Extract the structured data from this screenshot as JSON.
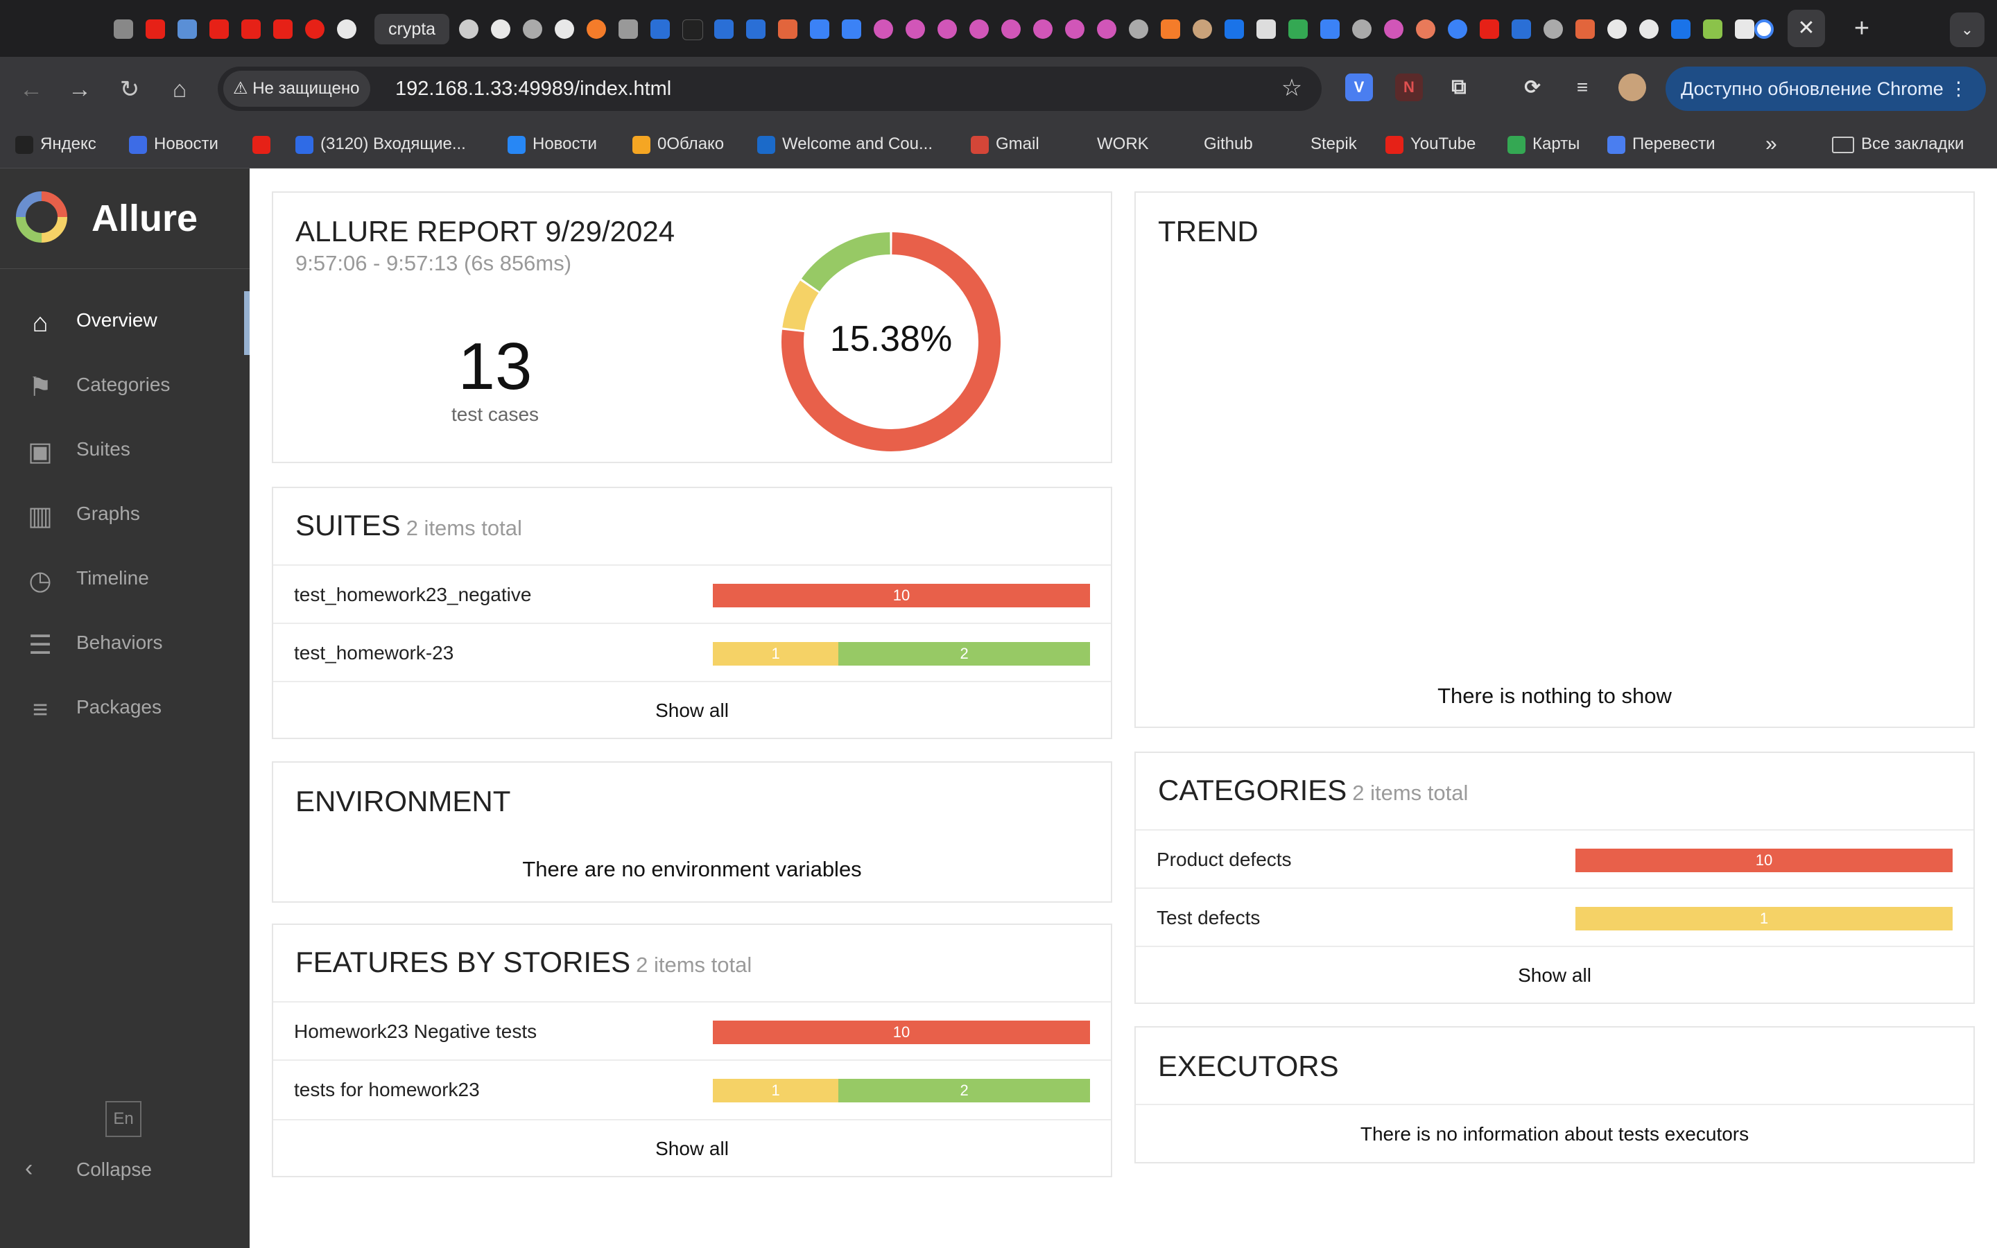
{
  "browser": {
    "active_tab_label": "crypta",
    "tab_close": "✕",
    "new_tab": "+",
    "tab_search": "⌄",
    "security_label": "Не защищено",
    "url": "192.168.1.33:49989/index.html",
    "update_button": "Доступно обновление Chrome",
    "bookmarks": [
      {
        "label": "Яндекс",
        "icon": "yandex-icon",
        "color": "#222222"
      },
      {
        "label": "Новости",
        "icon": "news-icon",
        "color": "#3d6ce6"
      },
      {
        "label": "",
        "icon": "youtube-icon",
        "color": "#e62117"
      },
      {
        "label": "(3120) Входящие...",
        "icon": "mail-icon",
        "color": "#2f6be6"
      },
      {
        "label": "Новости",
        "icon": "vk-icon",
        "color": "#2787f5"
      },
      {
        "label": "0Облако",
        "icon": "cloud-icon",
        "color": "#f5a623"
      },
      {
        "label": "Welcome and Cou...",
        "icon": "c-icon",
        "color": "#1b6ac9"
      },
      {
        "label": "Gmail",
        "icon": "gmail-icon",
        "color": "#d44638"
      },
      {
        "label": "WORK",
        "icon": "folder-icon",
        "color": "#38383b"
      },
      {
        "label": "Github",
        "icon": "github-icon",
        "color": "#38383b"
      },
      {
        "label": "Stepik",
        "icon": "stepik-icon",
        "color": "#38383b"
      },
      {
        "label": "YouTube",
        "icon": "youtube-icon",
        "color": "#e62117"
      },
      {
        "label": "Карты",
        "icon": "maps-icon",
        "color": "#34a853"
      },
      {
        "label": "Перевести",
        "icon": "translate-icon",
        "color": "#4a7ef0"
      }
    ],
    "more_bookmarks": "»",
    "all_bookmarks": "Все закладки"
  },
  "app": {
    "brand": "Allure",
    "nav": [
      {
        "label": "Overview",
        "icon": "home-icon",
        "active": true
      },
      {
        "label": "Categories",
        "icon": "flag-icon"
      },
      {
        "label": "Suites",
        "icon": "briefcase-icon"
      },
      {
        "label": "Graphs",
        "icon": "bar-chart-icon"
      },
      {
        "label": "Timeline",
        "icon": "clock-icon"
      },
      {
        "label": "Behaviors",
        "icon": "list-icon"
      },
      {
        "label": "Packages",
        "icon": "align-left-icon"
      }
    ],
    "language": "En",
    "collapse_label": "Collapse"
  },
  "summary": {
    "title": "ALLURE REPORT 9/29/2024",
    "time_range": "9:57:06 - 9:57:13 (6s 856ms)",
    "test_count": "13",
    "test_count_label": "test cases",
    "percent_label": "15.38%",
    "donut": {
      "failed": 10,
      "broken": 1,
      "passed": 2
    }
  },
  "colors": {
    "failed": "#e8604a",
    "broken": "#f5d266",
    "passed": "#97c965"
  },
  "suites": {
    "title": "SUITES",
    "subtitle": "2 items total",
    "rows": [
      {
        "name": "test_homework23_negative",
        "failed": 10,
        "broken": 0,
        "passed": 0
      },
      {
        "name": "test_homework-23",
        "failed": 0,
        "broken": 1,
        "passed": 2
      }
    ],
    "show_all": "Show all"
  },
  "environment": {
    "title": "ENVIRONMENT",
    "empty": "There are no environment variables"
  },
  "features": {
    "title": "FEATURES BY STORIES",
    "subtitle": "2 items total",
    "rows": [
      {
        "name": "Homework23 Negative tests",
        "failed": 10,
        "broken": 0,
        "passed": 0
      },
      {
        "name": "tests for homework23",
        "failed": 0,
        "broken": 1,
        "passed": 2
      }
    ],
    "show_all": "Show all"
  },
  "trend": {
    "title": "TREND",
    "empty": "There is nothing to show"
  },
  "categories": {
    "title": "CATEGORIES",
    "subtitle": "2 items total",
    "rows": [
      {
        "name": "Product defects",
        "failed": 10,
        "broken": 0,
        "passed": 0
      },
      {
        "name": "Test defects",
        "failed": 0,
        "broken": 1,
        "passed": 0
      }
    ],
    "show_all": "Show all"
  },
  "executors": {
    "title": "EXECUTORS",
    "empty": "There is no information about tests executors"
  }
}
